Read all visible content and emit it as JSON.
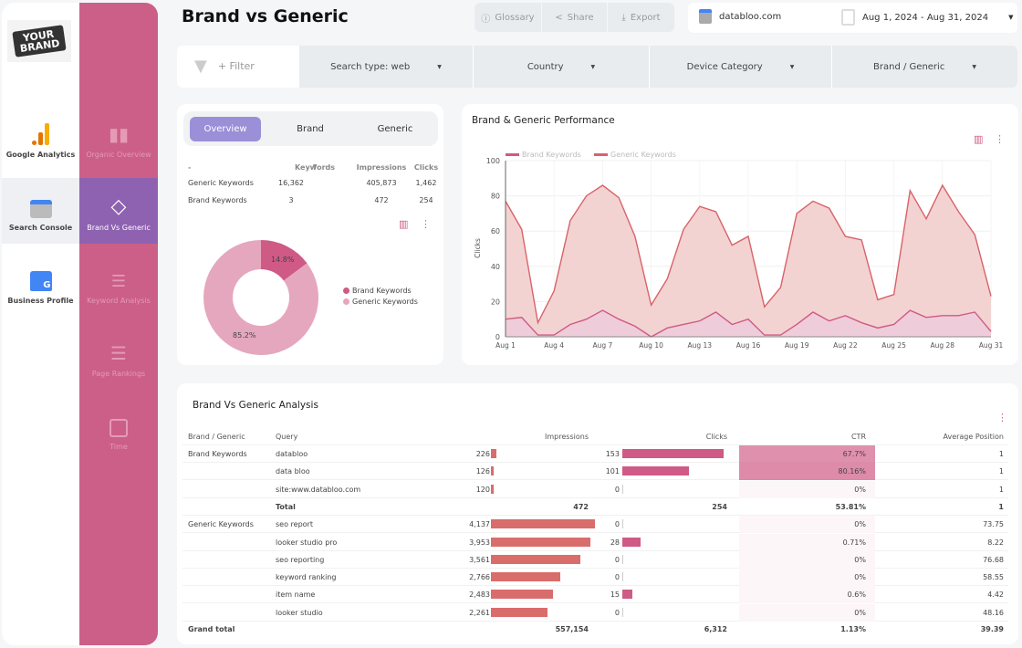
{
  "colors": {
    "sidebar": "#cc5f87",
    "active": "#8e62b0",
    "generic": "#d9626a",
    "brand": "#cf5a85",
    "tab_active": "#9b8fd8"
  },
  "logo": {
    "text": "YOUR BRAND"
  },
  "sources": [
    {
      "label": "Google Analytics",
      "icon": "analytics-icon"
    },
    {
      "label": "Search Console",
      "icon": "search-console-icon",
      "active": true
    },
    {
      "label": "Business Profile",
      "icon": "business-profile-icon"
    }
  ],
  "nav": [
    {
      "label": "Organic Overview",
      "icon": "bar-chart-icon"
    },
    {
      "label": "Brand Vs Generic",
      "icon": "tag-icon",
      "active": true
    },
    {
      "label": "Keyword Analysis",
      "icon": "list-search-icon"
    },
    {
      "label": "Page Rankings",
      "icon": "numbered-list-icon"
    },
    {
      "label": "Time",
      "icon": "calendar-icon"
    }
  ],
  "header": {
    "title": "Brand vs Generic",
    "glossary": "Glossary",
    "share": "Share",
    "export": "Export",
    "property": "databloo.com",
    "date_range": "Aug 1, 2024 - Aug 31, 2024"
  },
  "filters": {
    "add": "+ Filter",
    "items": [
      "Search type: web",
      "Country",
      "Device Category",
      "Brand / Generic"
    ]
  },
  "overview": {
    "tabs": [
      "Overview",
      "Brand",
      "Generic"
    ],
    "columns": [
      "-",
      "Keywords",
      "Impressions",
      "Clicks"
    ],
    "rows": [
      [
        "Generic Keywords",
        "16,362",
        "405,873",
        "1,462"
      ],
      [
        "Brand Keywords",
        "3",
        "472",
        "254"
      ]
    ]
  },
  "donut": {
    "slices": [
      {
        "name": "Brand Keywords",
        "value": 14.8,
        "label": "14.8%",
        "color": "#cf5a85"
      },
      {
        "name": "Generic Keywords",
        "value": 85.2,
        "label": "85.2%",
        "color": "#e5a7bd"
      }
    ]
  },
  "chart_data": {
    "type": "area",
    "title": "Brand & Generic Performance",
    "ylabel": "Clicks",
    "ylim": [
      0,
      100
    ],
    "yticks": [
      "0",
      "20",
      "40",
      "60",
      "80",
      "100"
    ],
    "grid": true,
    "legend": "top-left",
    "x": [
      "Aug 1",
      "Aug 2",
      "Aug 3",
      "Aug 4",
      "Aug 5",
      "Aug 6",
      "Aug 7",
      "Aug 8",
      "Aug 9",
      "Aug 10",
      "Aug 11",
      "Aug 12",
      "Aug 13",
      "Aug 14",
      "Aug 15",
      "Aug 16",
      "Aug 17",
      "Aug 18",
      "Aug 19",
      "Aug 20",
      "Aug 21",
      "Aug 22",
      "Aug 23",
      "Aug 24",
      "Aug 25",
      "Aug 26",
      "Aug 27",
      "Aug 28",
      "Aug 29",
      "Aug 30",
      "Aug 31"
    ],
    "xticks": [
      "Aug 1",
      "Aug 4",
      "Aug 7",
      "Aug 10",
      "Aug 13",
      "Aug 16",
      "Aug 19",
      "Aug 22",
      "Aug 25",
      "Aug 28",
      "Aug 31"
    ],
    "series": [
      {
        "name": "Generic Keywords",
        "color": "#d9626a",
        "values": [
          77,
          61,
          8,
          26,
          66,
          80,
          86,
          79,
          57,
          18,
          33,
          61,
          74,
          71,
          52,
          57,
          17,
          28,
          70,
          77,
          73,
          57,
          55,
          21,
          24,
          83,
          67,
          86,
          71,
          58,
          23
        ]
      },
      {
        "name": "Brand Keywords",
        "color": "#cf5a85",
        "values": [
          10,
          11,
          1,
          1,
          7,
          10,
          15,
          10,
          6,
          0,
          5,
          7,
          9,
          14,
          7,
          10,
          1,
          1,
          7,
          14,
          9,
          12,
          8,
          5,
          7,
          15,
          11,
          12,
          12,
          14,
          3
        ]
      }
    ]
  },
  "analysis": {
    "title": "Brand Vs Generic Analysis",
    "columns": [
      "Brand / Generic",
      "Query",
      "Impressions",
      "Clicks",
      "CTR",
      "Average Position"
    ],
    "rows": [
      {
        "group": "Brand Keywords",
        "query": "databloo",
        "impressions": "226",
        "imp": 226,
        "clicks": "153",
        "clk": 153,
        "ctr": "67.7%",
        "ctrv": 67.7,
        "pos": "1"
      },
      {
        "group": "",
        "query": "data bloo",
        "impressions": "126",
        "imp": 126,
        "clicks": "101",
        "clk": 101,
        "ctr": "80.16%",
        "ctrv": 80.16,
        "pos": "1"
      },
      {
        "group": "",
        "query": "site:www.databloo.com",
        "impressions": "120",
        "imp": 120,
        "clicks": "0",
        "clk": 0,
        "ctr": "0%",
        "ctrv": 0,
        "pos": "1"
      },
      {
        "group": "",
        "query": "Total",
        "impressions": "472",
        "clicks": "254",
        "ctr": "53.81%",
        "pos": "1",
        "total": true
      },
      {
        "group": "Generic Keywords",
        "query": "seo report",
        "impressions": "4,137",
        "imp": 4137,
        "clicks": "0",
        "clk": 0,
        "ctr": "0%",
        "ctrv": 0,
        "pos": "73.75"
      },
      {
        "group": "",
        "query": "looker studio pro",
        "impressions": "3,953",
        "imp": 3953,
        "clicks": "28",
        "clk": 28,
        "ctr": "0.71%",
        "ctrv": 0.71,
        "pos": "8.22"
      },
      {
        "group": "",
        "query": "seo reporting",
        "impressions": "3,561",
        "imp": 3561,
        "clicks": "0",
        "clk": 0,
        "ctr": "0%",
        "ctrv": 0,
        "pos": "76.68"
      },
      {
        "group": "",
        "query": "keyword ranking",
        "impressions": "2,766",
        "imp": 2766,
        "clicks": "0",
        "clk": 0,
        "ctr": "0%",
        "ctrv": 0,
        "pos": "58.55"
      },
      {
        "group": "",
        "query": "item name",
        "impressions": "2,483",
        "imp": 2483,
        "clicks": "15",
        "clk": 15,
        "ctr": "0.6%",
        "ctrv": 0.6,
        "pos": "4.42"
      },
      {
        "group": "",
        "query": "looker studio",
        "impressions": "2,261",
        "imp": 2261,
        "clicks": "0",
        "clk": 0,
        "ctr": "0%",
        "ctrv": 0,
        "pos": "48.16"
      }
    ],
    "grand_total": {
      "label": "Grand total",
      "impressions": "557,154",
      "clicks": "6,312",
      "ctr": "1.13%",
      "pos": "39.39"
    }
  }
}
